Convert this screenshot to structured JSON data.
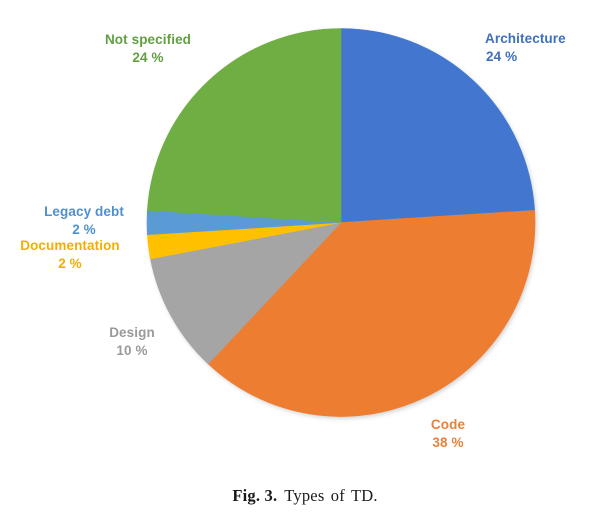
{
  "figure": {
    "caption_label": "Fig. 3.",
    "caption_text": "Types of TD."
  },
  "chart_data": {
    "type": "pie",
    "title": "Types of TD",
    "start_angle_deg": 0,
    "direction": "clockwise",
    "total_percent": 100,
    "categories": [
      "Architecture",
      "Code",
      "Design",
      "Documentation",
      "Legacy debt",
      "Not specified"
    ],
    "values": [
      24,
      38,
      10,
      2,
      2,
      24
    ],
    "value_suffix": "%",
    "colors": [
      "#4377CF",
      "#ED7D31",
      "#A5A5A5",
      "#FFC000",
      "#5B9BD5",
      "#6FAE43"
    ],
    "legend": "none",
    "grid": false,
    "slices": [
      {
        "name": "Architecture",
        "label": "Architecture",
        "percent_label": "24 %",
        "value": 24,
        "color": "#4377CF",
        "label_color": "#3f6fc0"
      },
      {
        "name": "Code",
        "label": "Code",
        "percent_label": "38 %",
        "value": 38,
        "color": "#ED7D31",
        "label_color": "#e8813a"
      },
      {
        "name": "Design",
        "label": "Design",
        "percent_label": "10 %",
        "value": 10,
        "color": "#A5A5A5",
        "label_color": "#9a9a9a"
      },
      {
        "name": "Documentation",
        "label": "Documentation",
        "percent_label": "2 %",
        "value": 2,
        "color": "#FFC000",
        "label_color": "#f3ae00"
      },
      {
        "name": "Legacy debt",
        "label": "Legacy debt",
        "percent_label": "2 %",
        "value": 2,
        "color": "#5B9BD5",
        "label_color": "#4f90cd"
      },
      {
        "name": "Not specified",
        "label": "Not specified",
        "percent_label": "24 %",
        "value": 24,
        "color": "#6FAE43",
        "label_color": "#61a041"
      }
    ]
  }
}
